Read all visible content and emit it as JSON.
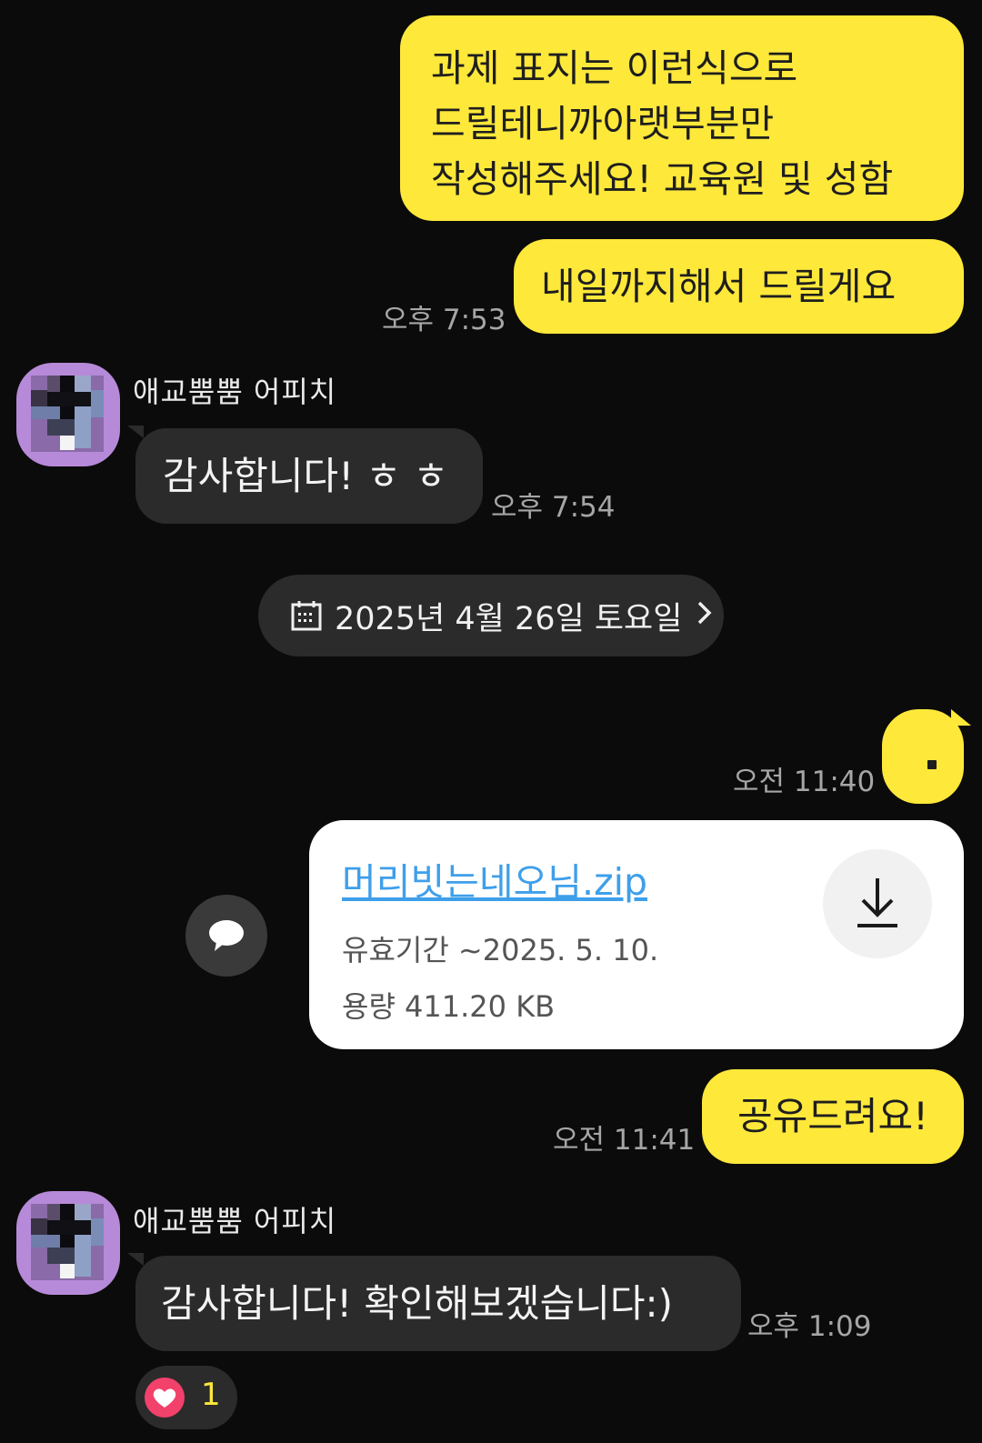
{
  "colors": {
    "background": "#0b0b0b",
    "my_bubble": "#fee83a",
    "other_bubble": "#2b2b2b",
    "file_link": "#3e9fea",
    "reaction_heart": "#f2416b"
  },
  "messages": {
    "m1_lines": [
      "과제 표지는 이런식으로",
      "드릴테니까아랫부분만",
      "작성해주세요! 교육원 및 성함"
    ],
    "m2": "내일까지해서 드릴게요",
    "m2_time": "오후 7:53",
    "sender_name_1": "애교뿜뿜 어피치",
    "m3": "감사합니다! ㅎ ㅎ",
    "m3_time": "오후 7:54",
    "date_divider": "2025년 4월 26일 토요일",
    "m4_time": "오전 11:40",
    "m6": "공유드려요!",
    "m6_time": "오전 11:41",
    "sender_name_2": "애교뿜뿜 어피치",
    "m7": "감사합니다! 확인해보겠습니다:)",
    "m7_time": "오후 1:09",
    "m7_reaction_count": "1"
  },
  "file": {
    "name": "머리빗는네오님.zip",
    "expiry": "유효기간 ~2025. 5. 10.",
    "size": "용량  411.20 KB"
  },
  "icons": {
    "date": "calendar-icon",
    "share": "speech-bubble-icon",
    "download": "download-icon",
    "reaction": "heart-icon",
    "chevron": "chevron-right-icon"
  }
}
